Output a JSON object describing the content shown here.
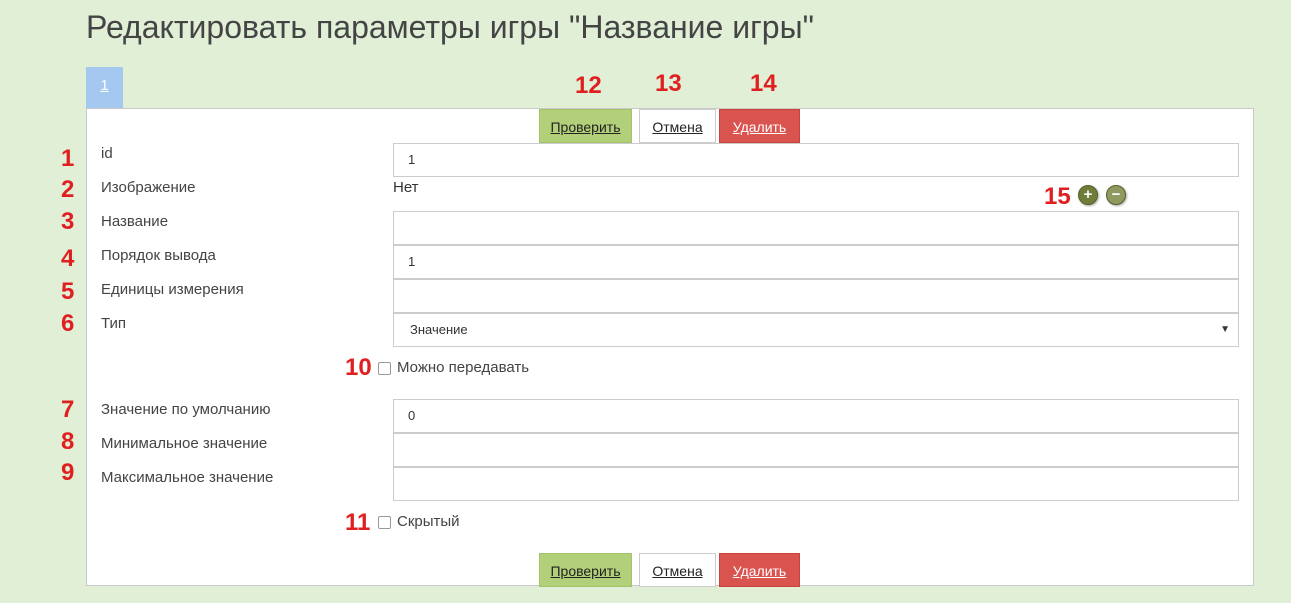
{
  "page": {
    "title": "Редактировать параметры игры \"Название игры\""
  },
  "tab": {
    "label": "1"
  },
  "buttons": {
    "check": "Проверить",
    "cancel": "Отмена",
    "delete": "Удалить"
  },
  "fields": {
    "id": {
      "label": "id",
      "value": "1"
    },
    "image": {
      "label": "Изображение",
      "value": "Нет"
    },
    "name": {
      "label": "Название",
      "value": ""
    },
    "order": {
      "label": "Порядок вывода",
      "value": "1"
    },
    "units": {
      "label": "Единицы измерения",
      "value": ""
    },
    "type": {
      "label": "Тип",
      "selected": "Значение"
    },
    "default": {
      "label": "Значение по умолчанию",
      "value": "0"
    },
    "min": {
      "label": "Минимальное значение",
      "value": ""
    },
    "max": {
      "label": "Максимальное значение",
      "value": ""
    }
  },
  "checkboxes": {
    "transferable": "Можно передавать",
    "hidden": "Скрытый"
  },
  "annotations": [
    "1",
    "2",
    "3",
    "4",
    "5",
    "6",
    "7",
    "8",
    "9",
    "10",
    "11",
    "12",
    "13",
    "14",
    "15"
  ],
  "icons": {
    "add": "plus-icon",
    "remove": "minus-icon",
    "select_caret": "caret-down-icon"
  },
  "colors": {
    "background": "#e1efd7",
    "check": "#b2cf7a",
    "delete": "#d9534f",
    "tab": "#a4c8f0",
    "annotation": "#e02020"
  }
}
